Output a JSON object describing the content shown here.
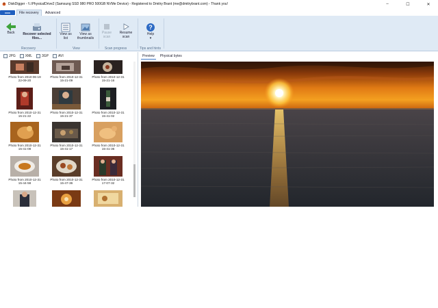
{
  "window": {
    "title": "DiskDigger - \\\\.\\PhysicalDrive2 (Samsung SSD 980 PRO 500GB NVMe Device) - Registered to Dmitry Brant (me@dmitrybrant.com) - Thank you!",
    "minimize": "–",
    "maximize": "☐",
    "close": "✕"
  },
  "tabs": {
    "file_menu": "",
    "items": [
      "File recovery",
      "Advanced"
    ],
    "active": "File recovery"
  },
  "ribbon": {
    "back": "Back",
    "recover": "Recover selected\nfiles...",
    "view_list": "View as\nlist",
    "view_thumbs": "View as\nthumbnails",
    "pause": "Pause\nscan",
    "resume": "Resume\nscan",
    "help": "Help",
    "help_arrow": "▾",
    "groups": [
      "Recovery",
      "View",
      "Scan progress",
      "Tips and hints"
    ]
  },
  "filters": [
    "JPG",
    "XML",
    "3GP",
    "AVI"
  ],
  "thumbnails": [
    "Photo from 2010-06-19\n22-09-20",
    "Photo from 2010-12-31\n15-21-09",
    "Photo from 2010-12-31\n15-21-16",
    "Photo from 2010-12-31\n15-21-22",
    "Photo from 2010-12-31\n15-21-37",
    "Photo from 2010-12-31\n15-41-02",
    "Photo from 2010-12-31\n15-41-08",
    "Photo from 2010-12-31\n15-41-17",
    "Photo from 2010-12-31\n15-41-36",
    "Photo from 2010-12-31\n15-44-58",
    "Photo from 2010-12-31\n15-47-36",
    "Photo from 2010-12-31\n17-07-32",
    "",
    "",
    ""
  ],
  "preview_tabs": [
    "Preview",
    "Physical bytes"
  ],
  "colors": {
    "accent": "#1f5fbf",
    "ribbon": "#dfeaf5",
    "sunset_sky": "#e07a14",
    "sea": "#2c3138"
  }
}
